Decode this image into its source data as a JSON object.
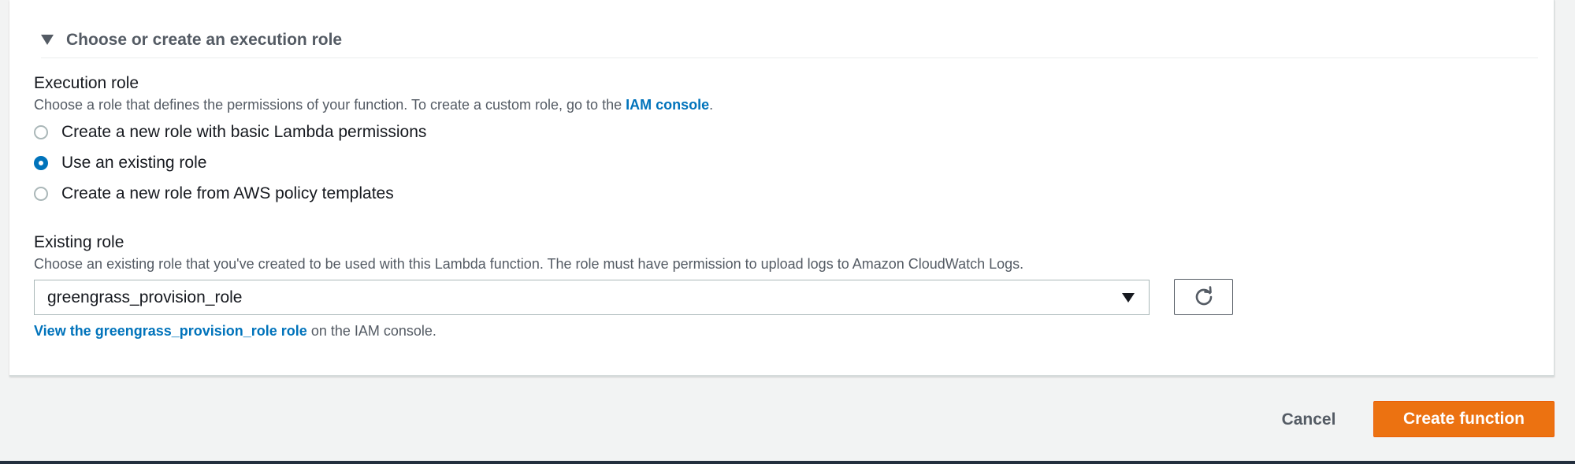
{
  "section": {
    "title": "Choose or create an execution role"
  },
  "execution_role": {
    "label": "Execution role",
    "description_prefix": "Choose a role that defines the permissions of your function. To create a custom role, go to the ",
    "iam_link": "IAM console",
    "description_suffix": ".",
    "options": [
      {
        "label": "Create a new role with basic Lambda permissions",
        "checked": false
      },
      {
        "label": "Use an existing role",
        "checked": true
      },
      {
        "label": "Create a new role from AWS policy templates",
        "checked": false
      }
    ]
  },
  "existing_role": {
    "label": "Existing role",
    "description": "Choose an existing role that you've created to be used with this Lambda function. The role must have permission to upload logs to Amazon CloudWatch Logs.",
    "selected_value": "greengrass_provision_role",
    "view_link": "View the greengrass_provision_role role",
    "view_suffix": " on the IAM console."
  },
  "actions": {
    "cancel": "Cancel",
    "create": "Create function"
  },
  "icons": {
    "caret": "caret-down-icon",
    "dropdown": "dropdown-arrow-icon",
    "refresh": "refresh-icon"
  },
  "colors": {
    "primary_button": "#ec7211",
    "link": "#0073bb",
    "radio_checked": "#0073bb"
  }
}
